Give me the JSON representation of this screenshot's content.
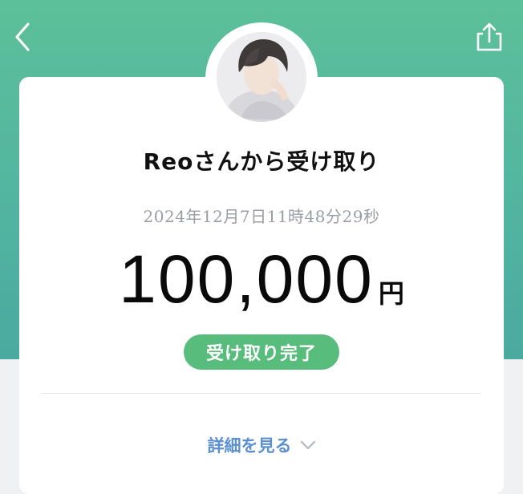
{
  "header": {
    "back_icon": "chevron-left-icon",
    "share_icon": "share-icon"
  },
  "avatar": {
    "icon": "user-avatar"
  },
  "transaction": {
    "title": "Reoさんから受け取り",
    "timestamp": "2024年12月7日11時48分29秒",
    "amount": "100,000",
    "currency": "円",
    "status": "受け取り完了"
  },
  "details": {
    "label": "詳細を見る",
    "icon": "chevron-down-icon"
  },
  "colors": {
    "brand_green": "#5cc09a",
    "status_green": "#58bd7c",
    "link_blue": "#5b8fd0",
    "timestamp_gray": "#9a9ca6"
  }
}
